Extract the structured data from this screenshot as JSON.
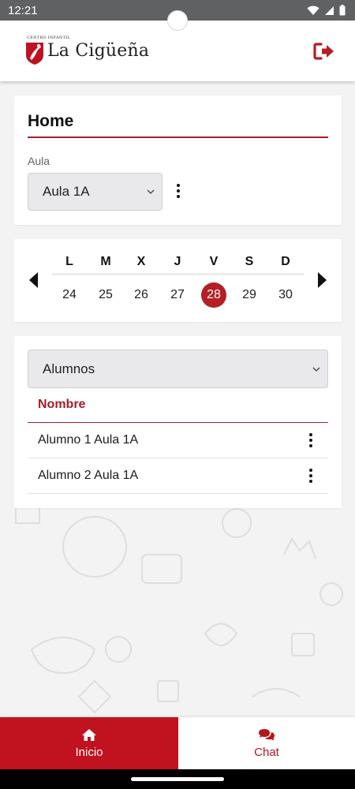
{
  "status_bar": {
    "time": "12:21",
    "icons": [
      "wifi-icon",
      "signal-icon",
      "battery-icon"
    ]
  },
  "app_bar": {
    "brand_small": "CENTRO INFANTIL",
    "brand_name": "La Cigüeña",
    "logout_icon": "logout-icon"
  },
  "home": {
    "title": "Home",
    "aula_label": "Aula",
    "aula_selected": "Aula 1A"
  },
  "calendar": {
    "days": [
      "L",
      "M",
      "X",
      "J",
      "V",
      "S",
      "D"
    ],
    "dates": [
      "24",
      "25",
      "26",
      "27",
      "28",
      "29",
      "30"
    ],
    "selected_index": 4
  },
  "alumnos": {
    "select_value": "Alumnos",
    "column_header": "Nombre",
    "rows": [
      {
        "name": "Alumno 1 Aula 1A"
      },
      {
        "name": "Alumno 2 Aula 1A"
      }
    ]
  },
  "bottom_nav": {
    "items": [
      {
        "label": "Inicio",
        "icon": "home-icon",
        "active": true
      },
      {
        "label": "Chat",
        "icon": "chat-icon",
        "active": false
      }
    ]
  },
  "colors": {
    "accent": "#a51d2d",
    "nav_active": "#c1121f",
    "selected_date": "#b51f24"
  }
}
